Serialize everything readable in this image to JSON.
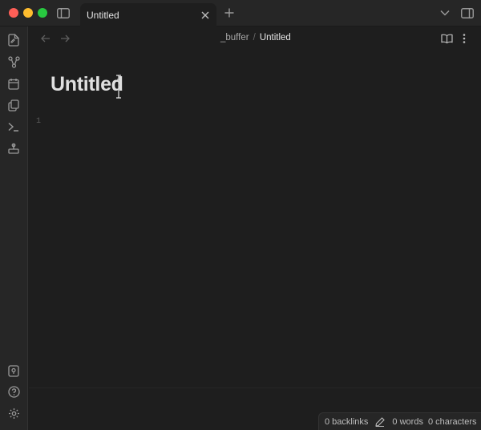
{
  "window": {
    "tab_title": "Untitled"
  },
  "icons": {
    "sidebar_toggle": "sidebar-left-icon",
    "tab_close": "close-icon",
    "new_tab": "plus-icon",
    "tab_list": "chevron-down-icon",
    "right_sidebar": "sidebar-right-icon",
    "ribbon": [
      "files-icon",
      "graph-icon",
      "calendar-icon",
      "copy-icon",
      "terminal-icon",
      "stamp-icon"
    ],
    "ribbon_bottom": [
      "vault-map-icon",
      "help-icon",
      "settings-icon"
    ]
  },
  "navigation": {
    "breadcrumb_folder": "_buffer",
    "breadcrumb_separator": "/",
    "breadcrumb_file": "Untitled"
  },
  "editor": {
    "title": "Untitled",
    "line_number": "1"
  },
  "statusbar": {
    "backlinks": "0 backlinks",
    "words": "0 words",
    "characters": "0 characters"
  },
  "colors": {
    "background": "#1e1e1e",
    "chrome": "#262626",
    "close": "#fe5f57",
    "minimize": "#febc2e",
    "maximize": "#28c840"
  }
}
